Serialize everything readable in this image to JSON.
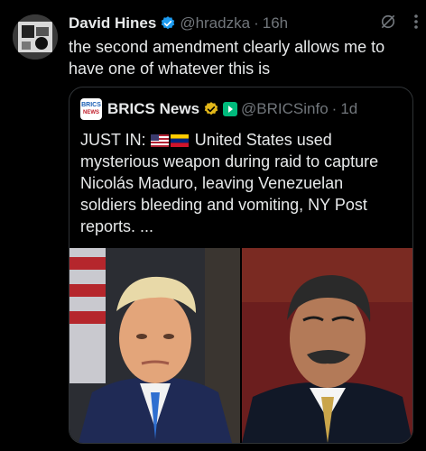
{
  "tweet": {
    "author_name": "David Hines",
    "author_handle": "@hradzka",
    "separator": "·",
    "time": "16h",
    "text": "the second amendment clearly allows me to have one of whatever this is",
    "verified_icon": "verified-badge-icon",
    "grok_icon": "grok-icon",
    "more_icon": "more-options-icon"
  },
  "quote": {
    "logo_line1": "BRICS",
    "logo_line2": "NEWS",
    "author_name": "BRICS News",
    "author_handle": "@BRICSinfo",
    "separator": "·",
    "time": "1d",
    "text_prefix": "JUST IN: ",
    "flags": [
      "us-flag-icon",
      "venezuela-flag-icon"
    ],
    "text_body": " United States used mysterious weapon during raid to capture Nicolás Maduro, leaving Venezuelan soldiers bleeding and vomiting, NY Post reports. ...",
    "photos": [
      "trump-portrait-image",
      "maduro-portrait-image"
    ]
  },
  "colors": {
    "background": "#000000",
    "text": "#e7e9ea",
    "muted": "#71767b",
    "border": "#2f3336",
    "verified_blue": "#1d9bf0",
    "gold_badge": "#e2b719",
    "green_badge": "#00ba7c"
  }
}
